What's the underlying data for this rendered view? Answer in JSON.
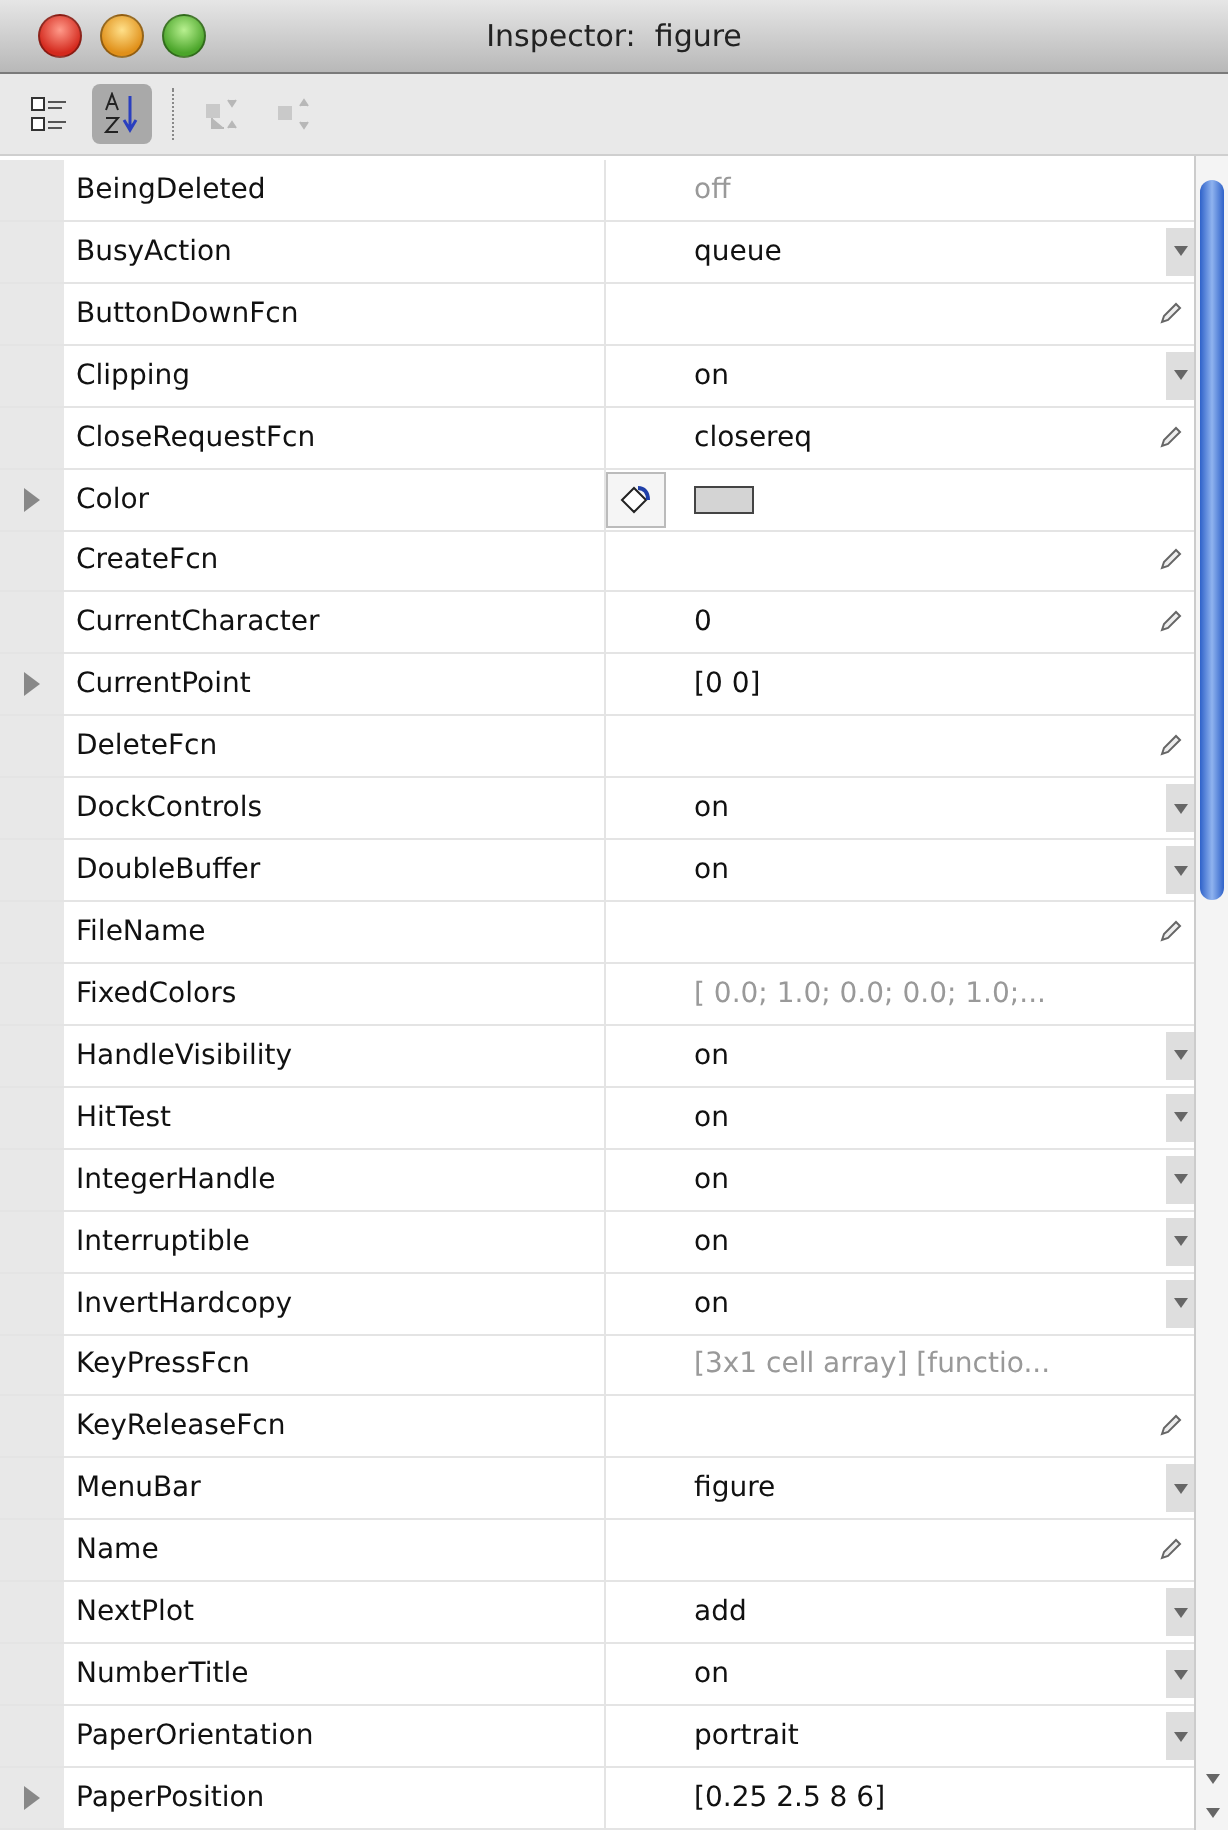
{
  "window": {
    "title": "Inspector:  figure"
  },
  "toolbar": [
    {
      "kind": "categorized",
      "selected": false,
      "disabled": false
    },
    {
      "kind": "alphabetical",
      "selected": true,
      "disabled": false
    },
    {
      "kind": "expand",
      "selected": false,
      "disabled": true
    },
    {
      "kind": "collapse",
      "selected": false,
      "disabled": true
    }
  ],
  "properties": [
    {
      "name": "BeingDeleted",
      "kind": "readonly",
      "value": "off",
      "expandable": false
    },
    {
      "name": "BusyAction",
      "kind": "dropdown",
      "value": "queue",
      "expandable": false
    },
    {
      "name": "ButtonDownFcn",
      "kind": "edit",
      "expandable": false
    },
    {
      "name": "Clipping",
      "kind": "dropdown",
      "value": "on",
      "expandable": false
    },
    {
      "name": "CloseRequestFcn",
      "kind": "edit",
      "value": "closereq",
      "expandable": false
    },
    {
      "name": "Color",
      "kind": "color",
      "color": "#d4d4d4",
      "expandable": true
    },
    {
      "name": "CreateFcn",
      "kind": "edit",
      "expandable": false
    },
    {
      "name": "CurrentCharacter",
      "kind": "edit",
      "value": "0",
      "expandable": false
    },
    {
      "name": "CurrentPoint",
      "kind": "plain",
      "value": "[0 0]",
      "expandable": true
    },
    {
      "name": "DeleteFcn",
      "kind": "edit",
      "expandable": false
    },
    {
      "name": "DockControls",
      "kind": "dropdown",
      "value": "on",
      "expandable": false
    },
    {
      "name": "DoubleBuffer",
      "kind": "dropdown",
      "value": "on",
      "expandable": false
    },
    {
      "name": "FileName",
      "kind": "edit",
      "expandable": false
    },
    {
      "name": "FixedColors",
      "kind": "readonly",
      "value": "[ 0.0; 1.0; 0.0; 0.0; 1.0;...",
      "expandable": false
    },
    {
      "name": "HandleVisibility",
      "kind": "dropdown",
      "value": "on",
      "expandable": false
    },
    {
      "name": "HitTest",
      "kind": "dropdown",
      "value": "on",
      "expandable": false
    },
    {
      "name": "IntegerHandle",
      "kind": "dropdown",
      "value": "on",
      "expandable": false
    },
    {
      "name": "Interruptible",
      "kind": "dropdown",
      "value": "on",
      "expandable": false
    },
    {
      "name": "InvertHardcopy",
      "kind": "dropdown",
      "value": "on",
      "expandable": false
    },
    {
      "name": "KeyPressFcn",
      "kind": "readonly",
      "value": "[3x1  cell array] [functio...",
      "expandable": false
    },
    {
      "name": "KeyReleaseFcn",
      "kind": "edit",
      "expandable": false
    },
    {
      "name": "MenuBar",
      "kind": "dropdown",
      "value": "figure",
      "expandable": false
    },
    {
      "name": "Name",
      "kind": "edit",
      "expandable": false
    },
    {
      "name": "NextPlot",
      "kind": "dropdown",
      "value": "add",
      "expandable": false
    },
    {
      "name": "NumberTitle",
      "kind": "dropdown",
      "value": "on",
      "expandable": false
    },
    {
      "name": "PaperOrientation",
      "kind": "dropdown",
      "value": "portrait",
      "expandable": false
    },
    {
      "name": "PaperPosition",
      "kind": "plain",
      "value": "[0.25 2.5 8 6]",
      "expandable": true
    }
  ]
}
